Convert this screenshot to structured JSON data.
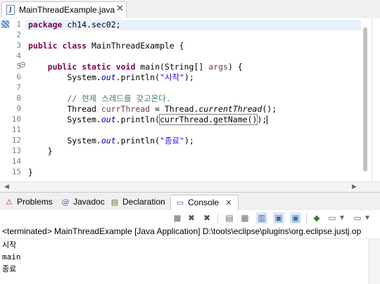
{
  "editor_tab": {
    "filename": "MainThreadExample.java",
    "close": "✕",
    "icon": "J"
  },
  "code": {
    "line_numbers": [
      "1",
      "2",
      "3",
      "4",
      "5",
      "6",
      "7",
      "8",
      "9",
      "10",
      "11",
      "12",
      "13",
      "14",
      "15"
    ],
    "lines": [
      [
        {
          "t": "package",
          "s": "kw"
        },
        {
          "t": " ch14.sec02;"
        }
      ],
      [],
      [
        {
          "t": "public",
          "s": "kw"
        },
        {
          "t": " "
        },
        {
          "t": "class",
          "s": "kw"
        },
        {
          "t": " MainThreadExample {"
        }
      ],
      [],
      [
        {
          "t": "    "
        },
        {
          "t": "public",
          "s": "kw"
        },
        {
          "t": " "
        },
        {
          "t": "static",
          "s": "kw"
        },
        {
          "t": " "
        },
        {
          "t": "void",
          "s": "kw"
        },
        {
          "t": " main(String[] "
        },
        {
          "t": "args",
          "s": "var"
        },
        {
          "t": ") {"
        }
      ],
      [
        {
          "t": "        System."
        },
        {
          "t": "out",
          "s": "fld"
        },
        {
          "t": ".println("
        },
        {
          "t": "\"시작\"",
          "s": "str"
        },
        {
          "t": ");"
        }
      ],
      [],
      [
        {
          "t": "        "
        },
        {
          "t": "// 현제 스레드를 갖고온다.",
          "s": "cm"
        }
      ],
      [
        {
          "t": "        Thread "
        },
        {
          "t": "currThread",
          "s": "var"
        },
        {
          "t": " = Thread."
        },
        {
          "t": "currentThread",
          "s": "itl"
        },
        {
          "t": "();"
        }
      ],
      [
        {
          "t": "        System."
        },
        {
          "t": "out",
          "s": "fld"
        },
        {
          "t": ".println("
        },
        {
          "t": "currThread.getName()",
          "s": "boxed"
        },
        {
          "t": ");"
        },
        {
          "t": "",
          "s": "caret"
        }
      ],
      [],
      [
        {
          "t": "        System."
        },
        {
          "t": "out",
          "s": "fld"
        },
        {
          "t": ".println("
        },
        {
          "t": "\"종료\"",
          "s": "str"
        },
        {
          "t": ");"
        }
      ],
      [
        {
          "t": "    }"
        }
      ],
      [],
      [
        {
          "t": "}"
        }
      ]
    ]
  },
  "views": {
    "tabs": [
      {
        "label": "Problems",
        "icon": "problems-icon",
        "glyph": "⚠"
      },
      {
        "label": "Javadoc",
        "icon": "javadoc-icon",
        "glyph": "@"
      },
      {
        "label": "Declaration",
        "icon": "declaration-icon",
        "glyph": "▤"
      },
      {
        "label": "Console",
        "icon": "console-icon",
        "glyph": "▭"
      }
    ]
  },
  "console": {
    "status": "<terminated> MainThreadExample [Java Application] D:\\tools\\eclipse\\plugins\\org.eclipse.justj.op",
    "output": [
      "시작",
      "main",
      "종료"
    ]
  },
  "colors": {
    "keyword": "#7f0055",
    "string": "#2a00ff",
    "comment": "#3f7f5f",
    "field": "#0000c0",
    "variable": "#6a3e3e",
    "highlight": "#e8f2fe"
  }
}
